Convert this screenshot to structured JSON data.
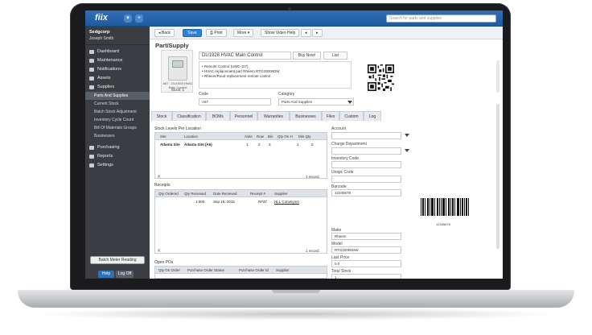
{
  "app": {
    "logo": "fiix",
    "search_placeholder": "Search for parts and supplies"
  },
  "sidebar": {
    "org": "Sedgcorp",
    "user": "Joseph Smith",
    "items": [
      {
        "label": "Dashboard",
        "icon": "dashboard-icon"
      },
      {
        "label": "Maintenance",
        "icon": "wrench-icon"
      },
      {
        "label": "Notifications",
        "icon": "bell-icon"
      },
      {
        "label": "Assets",
        "icon": "asset-icon"
      },
      {
        "label": "Supplies",
        "icon": "box-icon"
      }
    ],
    "sub_items": [
      "Parts And Supplies",
      "Current Stock",
      "Batch Stock Adjustment",
      "Inventory Cycle Count",
      "Bill Of Materials Groups",
      "Businesses"
    ],
    "items2": [
      {
        "label": "Purchasing",
        "icon": "cart-icon"
      },
      {
        "label": "Reports",
        "icon": "report-icon"
      },
      {
        "label": "Settings",
        "icon": "gear-icon"
      }
    ],
    "meter_button": "Batch Meter Reading",
    "help": "Help",
    "logoff": "Log Off"
  },
  "toolbar": {
    "back": "Back",
    "save": "Save",
    "print": "Print",
    "more": "More",
    "video": "Show Video Help"
  },
  "page": {
    "title": "Part/Supply",
    "photo_caption": "A67 - DU1928 HVAC Main Control",
    "stock": "Stock: 1",
    "name": "DU1928 HVAC Main Control",
    "buy_now": "Buy Now!",
    "list": "List",
    "description": [
      "Remote Control (UMC-117)",
      "HVAC replacement part Rheem RTG20006DW",
      "Rheem/Ruud replacement remote control"
    ],
    "code_label": "Code",
    "code_value": "A67",
    "category_label": "Category",
    "category_value": "Parts And Supplies"
  },
  "tabs": [
    "Stock",
    "Classification",
    "BOMs",
    "Personnel",
    "Warranties",
    "Businesses",
    "Files",
    "Custom",
    "Log"
  ],
  "stock_levels": {
    "title": "Stock Levels Per Location",
    "headers": [
      "Site",
      "Location",
      "Aisle",
      "Row",
      "Bin",
      "Qty On H",
      "Min Qty"
    ],
    "rows": [
      [
        "Atlanta Site",
        "Atlanta Site (A6)",
        "1",
        "2",
        "3",
        "1",
        "0"
      ]
    ],
    "records": "1 record."
  },
  "receipts": {
    "title": "Receipts",
    "headers": [
      "Qty Ordered",
      "Qty Received",
      "Date Received",
      "Receipt #",
      "Supplier"
    ],
    "rows": [
      [
        "",
        "1.000",
        "Sep 18, 2015",
        "R#37",
        "HLL Conveyors"
      ]
    ],
    "records": "1 record."
  },
  "open_pos": {
    "title": "Open POs",
    "headers": [
      "Qty On Order",
      "Purchase Order Status",
      "Purchase Order Id",
      "Supplier"
    ]
  },
  "right_fields": {
    "account_label": "Account",
    "charge_label": "Charge Department",
    "inventory_label": "Inventory Code",
    "unspc_label": "Unspc Code",
    "barcode_label": "Barcode",
    "barcode_value": "12345678",
    "barcode_text": "12345678",
    "make_label": "Make",
    "make_value": "Rheem",
    "model_label": "Model",
    "model_value": "RTG20006DW",
    "last_price_label": "Last Price",
    "last_price_value": "0.0",
    "total_stock_label": "Total Stock",
    "total_stock_value": "1"
  }
}
